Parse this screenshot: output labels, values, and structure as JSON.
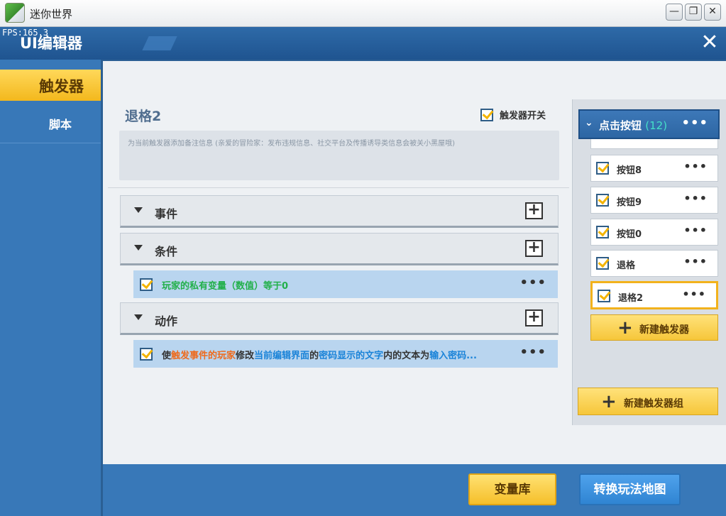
{
  "window": {
    "title": "迷你世界",
    "controls": {
      "minimize": "—",
      "restore": "❐",
      "close": "✕"
    }
  },
  "overlay": {
    "fps": "FPS:165.3"
  },
  "editor": {
    "title": "UI编辑器",
    "close": "✕"
  },
  "sidebar": {
    "items": [
      {
        "label": "触发器",
        "active": true
      },
      {
        "label": "脚本",
        "active": false
      }
    ]
  },
  "trigger": {
    "name": "退格2",
    "switch_label": "触发器开关",
    "switch_checked": true,
    "note": "为当前触发器添加备注信息 (亲爱的冒险家：发布违规信息、社交平台及传播诱导类信息会被关小黑屋哦)"
  },
  "sections": {
    "event": {
      "label": "事件",
      "add": "+"
    },
    "condition": {
      "label": "条件",
      "add": "+",
      "entry": {
        "text": "玩家的私有变量（数值）等于0",
        "more": "•••"
      }
    },
    "action": {
      "label": "动作",
      "add": "+",
      "entry": {
        "parts": [
          "使",
          "触发事件的玩家",
          "修改",
          "当前编辑界面",
          "的",
          "密码显示的文字",
          "内的文本为",
          "输入密码..."
        ],
        "more": "•••"
      }
    }
  },
  "trigger_list": {
    "group": {
      "chevron": "⌄",
      "name": "点击按钮",
      "count": "(12)",
      "more": "•••"
    },
    "items": [
      {
        "label": "按钮8",
        "more": "•••"
      },
      {
        "label": "按钮9",
        "more": "•••"
      },
      {
        "label": "按钮0",
        "more": "•••"
      },
      {
        "label": "退格",
        "more": "•••"
      },
      {
        "label": "退格2",
        "more": "•••",
        "selected": true
      }
    ],
    "new_trigger": {
      "icon": "+",
      "label": "新建触发器"
    },
    "new_group": {
      "icon": "+",
      "label": "新建触发器组"
    }
  },
  "footer": {
    "variable_library": "变量库",
    "convert_map": "转换玩法地图"
  },
  "colors": {
    "accent_yellow": "#f6c63a",
    "header_blue": "#2e6aa8",
    "entry_blue": "#b9d5ef",
    "text_green": "#22b04a",
    "text_orange": "#ee6a1c",
    "text_blue": "#1a83d8"
  }
}
